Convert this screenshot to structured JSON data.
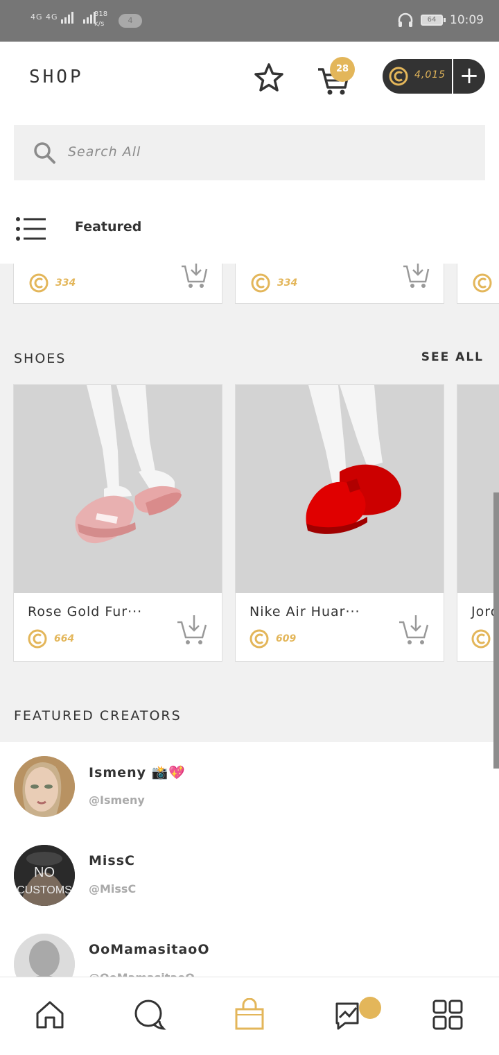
{
  "status_bar": {
    "network": "4G 4G",
    "speed_value": "318",
    "speed_unit": "k/s",
    "notifications": "4",
    "battery": "64",
    "time": "10:09"
  },
  "header": {
    "title": "SHOP",
    "cart_count": "28",
    "coin_balance": "4,015",
    "add_coins": "+"
  },
  "search": {
    "placeholder": "Search All"
  },
  "category": {
    "label": "Featured"
  },
  "featured_strip": {
    "prices": [
      "334",
      "334",
      ""
    ]
  },
  "shoes": {
    "title": "SHOES",
    "see_all": "SEE ALL",
    "items": [
      {
        "name": "Rose Gold Fur···",
        "price": "664"
      },
      {
        "name": "Nike Air Huar···",
        "price": "609"
      },
      {
        "name": "Jord",
        "price": ""
      }
    ]
  },
  "featured_creators": {
    "title": "FEATURED CREATORS",
    "creators": [
      {
        "name": "Ismeny 📸💖",
        "handle": "@Ismeny"
      },
      {
        "name": "MissC",
        "handle": "@MissC",
        "avatar_text": "NO CUSTOMS"
      },
      {
        "name": "OoMamasitaoO",
        "handle": "@OoMamasitaoO"
      }
    ]
  },
  "colors": {
    "accent": "#e3b65a",
    "dark": "#333333",
    "status_bar": "#767676"
  },
  "bottom_nav": {
    "items": [
      "home-icon",
      "chat-icon",
      "shop-bag-icon",
      "activity-icon",
      "grid-icon"
    ],
    "active": "shop-bag-icon"
  }
}
